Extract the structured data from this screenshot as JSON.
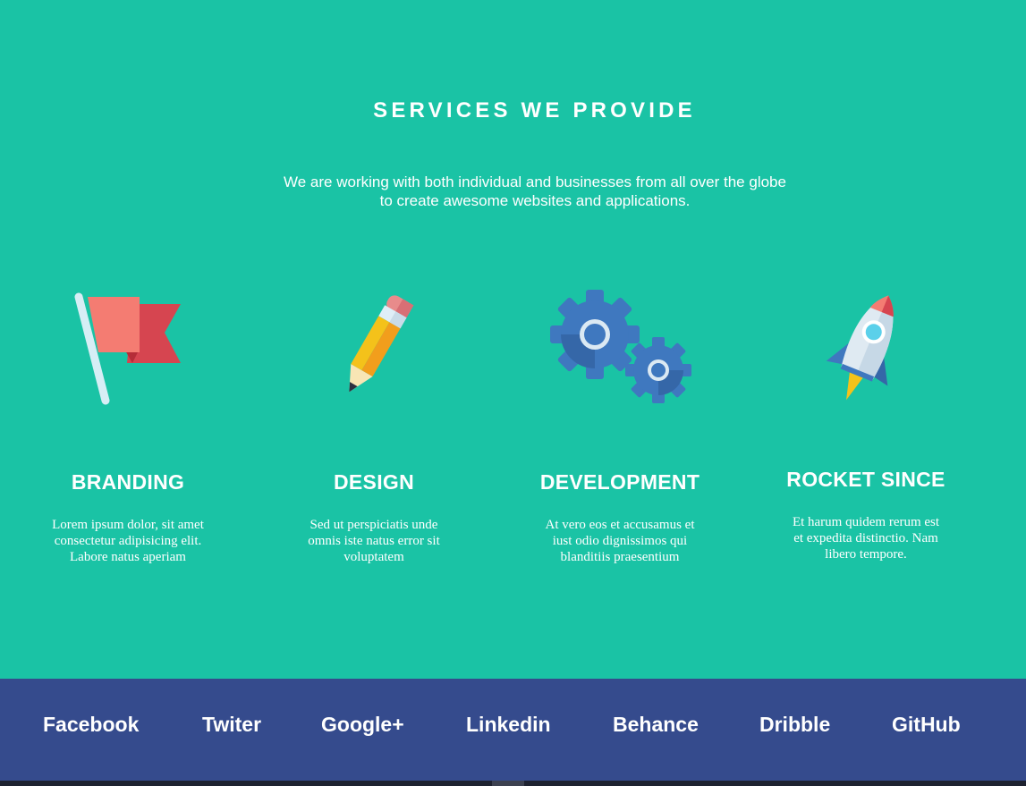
{
  "header": {
    "title": "SERVICES WE PROVIDE",
    "subtitle_line1": "We are working with both individual and businesses from all over the globe",
    "subtitle_line2": "to create awesome websites and applications."
  },
  "services": [
    {
      "icon": "flag-icon",
      "title": "BRANDING",
      "text_line1": "Lorem ipsum dolor, sit amet",
      "text_line2": "consectetur adipisicing elit.",
      "text_line3": "Labore natus aperiam"
    },
    {
      "icon": "pencil-icon",
      "title": "DESIGN",
      "text_line1": "Sed ut perspiciatis unde",
      "text_line2": "omnis iste natus error sit",
      "text_line3": "voluptatem"
    },
    {
      "icon": "gears-icon",
      "title": "DEVELOPMENT",
      "text_line1": "At vero eos et accusamus et",
      "text_line2": "iust odio dignissimos qui",
      "text_line3": "blanditiis praesentium"
    },
    {
      "icon": "rocket-icon",
      "title": "ROCKET SINCE",
      "text_line1": "Et harum quidem rerum est",
      "text_line2": "et expedita distinctio. Nam",
      "text_line3": "libero tempore."
    }
  ],
  "footer": {
    "links": [
      "Facebook",
      "Twiter",
      "Google+",
      "Linkedin",
      "Behance",
      "Dribble",
      "GitHub"
    ]
  },
  "colors": {
    "section_background": "#1ac3a5",
    "footer_background": "#354b8d",
    "text": "#ffffff"
  }
}
